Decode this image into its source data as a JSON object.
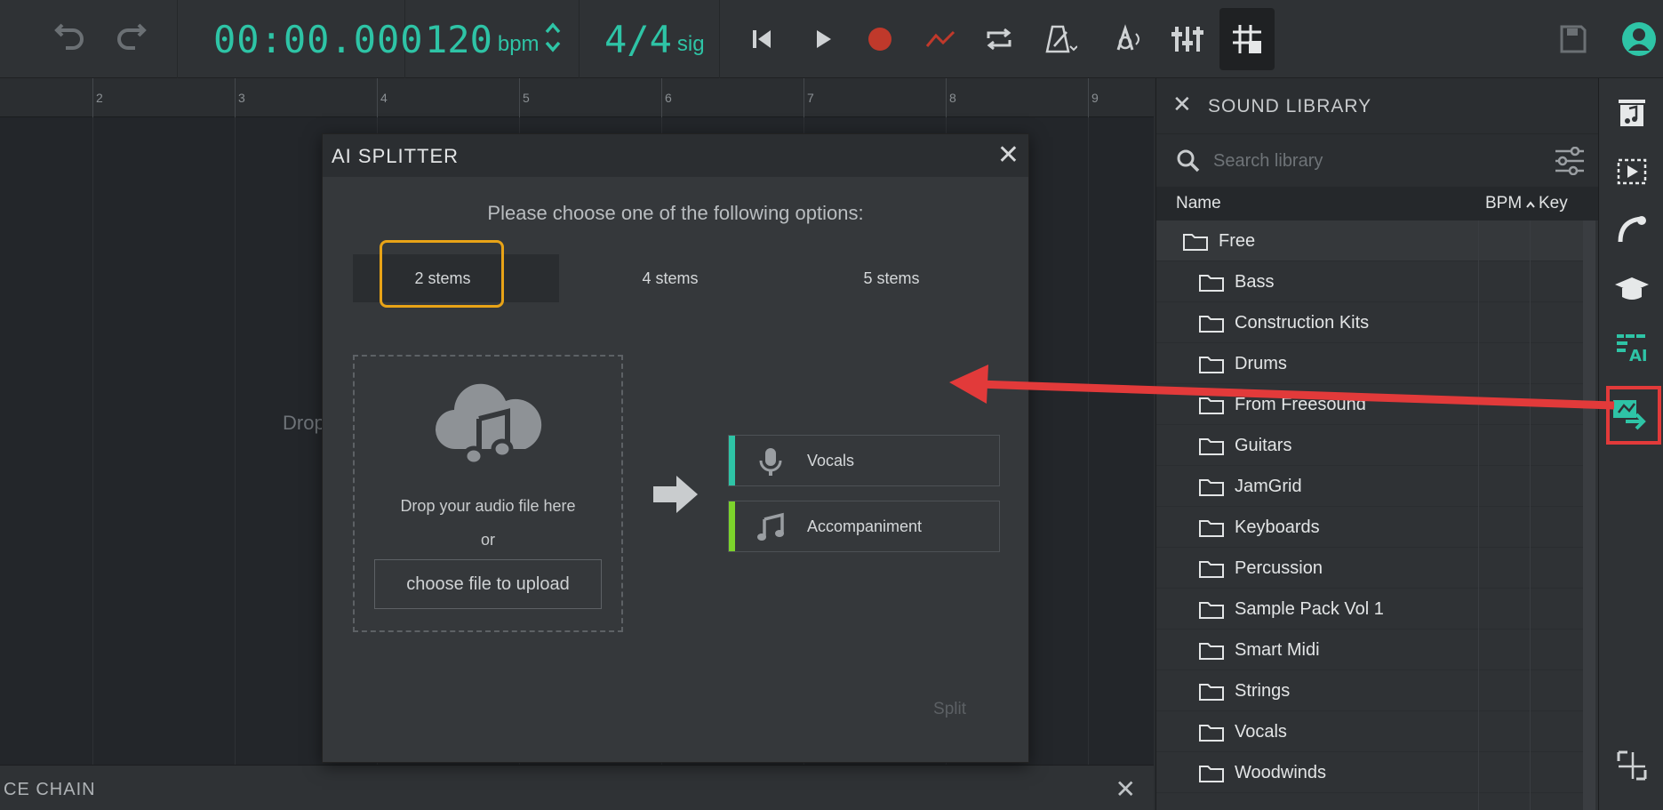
{
  "toolbar": {
    "time": "00:00.000",
    "bpm_value": "120",
    "bpm_label": "bpm",
    "sig_value": "4/4",
    "sig_label": "sig"
  },
  "timeline": {
    "bars": [
      "2",
      "3",
      "4",
      "5",
      "6",
      "7",
      "8",
      "9"
    ],
    "drop_hint": "Drop"
  },
  "fx_chain": {
    "title": "CE CHAIN"
  },
  "modal": {
    "title": "AI SPLITTER",
    "prompt": "Please choose one of the following options:",
    "stem_options": [
      "2 stems",
      "4 stems",
      "5 stems"
    ],
    "selected_stem": "2 stems",
    "drop_text": "Drop your audio file here",
    "or_text": "or",
    "upload_label": "choose file to upload",
    "outputs": [
      {
        "label": "Vocals",
        "color": "#2ec4a6",
        "icon": "microphone-icon"
      },
      {
        "label": "Accompaniment",
        "color": "#7cd32b",
        "icon": "music-note-icon"
      }
    ],
    "split_label": "Split"
  },
  "library": {
    "title": "SOUND LIBRARY",
    "search_placeholder": "Search library",
    "columns": {
      "name": "Name",
      "bpm": "BPM",
      "key": "Key"
    },
    "root_folder": "Free",
    "folders": [
      "Bass",
      "Construction Kits",
      "Drums",
      "From Freesound",
      "Guitars",
      "JamGrid",
      "Keyboards",
      "Percussion",
      "Sample Pack Vol 1",
      "Smart Midi",
      "Strings",
      "Vocals",
      "Woodwinds"
    ]
  },
  "colors": {
    "accent": "#2ec4a6",
    "record": "#c0392b",
    "highlight": "#e8a317",
    "annotation": "#e23a3a"
  }
}
